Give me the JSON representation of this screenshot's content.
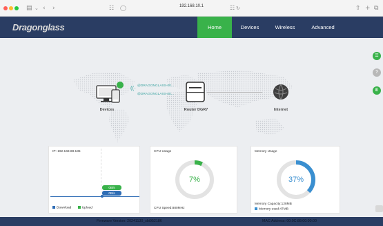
{
  "browser": {
    "url": "192.168.10.1",
    "icons": [
      "sidebar-icon",
      "chevron-down-icon",
      "back-icon",
      "forward-icon",
      "site-settings-icon",
      "shield-icon",
      "translate-icon",
      "reload-icon",
      "share-icon",
      "new-tab-icon",
      "tabs-icon"
    ]
  },
  "brand": "Dragonglass",
  "nav": {
    "items": [
      {
        "label": "Home",
        "active": true
      },
      {
        "label": "Devices",
        "active": false
      },
      {
        "label": "Wireless",
        "active": false
      },
      {
        "label": "Advanced",
        "active": false
      }
    ],
    "active_color": "#39b24a",
    "bar_color": "#2a3d63"
  },
  "topology": {
    "devices_label": "Devices",
    "router_label": "Router DGR7",
    "internet_label": "Internet",
    "ssids": [
      "@DRAGONGLASS-00...",
      "@DRAGONGLASS-00..."
    ]
  },
  "side_buttons": [
    {
      "icon": "network-icon",
      "color": "#39b24a"
    },
    {
      "icon": "help-icon",
      "color": "#b8b8b8"
    },
    {
      "icon": "language-icon",
      "color": "#39b24a",
      "label": "E"
    }
  ],
  "traffic_card": {
    "ip_label": "IP:  192.168.88.185",
    "download_rate": "0B/s",
    "upload_rate": "0B/s",
    "legend": [
      {
        "label": "Download",
        "color": "#2f6db5"
      },
      {
        "label": "Upload",
        "color": "#39b24a"
      }
    ]
  },
  "cpu_card": {
    "title": "CPU Usage",
    "percent": 7,
    "percent_label": "7%",
    "speed": "CPU Speed:880MHz",
    "arc_color": "#39b24a"
  },
  "memory_card": {
    "title": "Memory Usage",
    "percent": 37,
    "percent_label": "37%",
    "capacity": "Memory Capacity:128MB",
    "used": "Memory used:47MB",
    "arc_color": "#3a8fd0"
  },
  "footer": {
    "firmware": "Firmware Version:  20241130_sbi952186",
    "mac": "MAC Address:  00:0C:88:00:00:00"
  }
}
